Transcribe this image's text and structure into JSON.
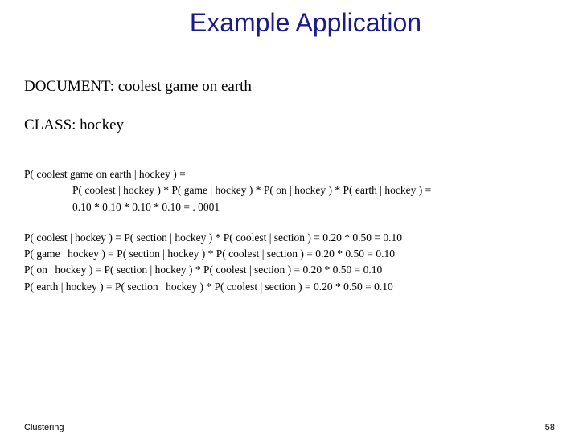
{
  "title": "Example Application",
  "document": {
    "label": "DOCUMENT:",
    "value": "coolest game on earth"
  },
  "class": {
    "label": "CLASS:",
    "value": "hockey"
  },
  "probability": {
    "main_line": "P( coolest game on earth | hockey ) =",
    "expansion": "P( coolest | hockey ) * P( game | hockey ) * P( on | hockey ) * P( earth | hockey ) =",
    "numeric": "0.10 * 0.10 * 0.10 * 0.10 = . 0001"
  },
  "details": [
    "P( coolest | hockey ) = P( section | hockey ) * P( coolest | section ) = 0.20 * 0.50 = 0.10",
    "P( game | hockey ) = P( section | hockey ) * P( coolest | section ) = 0.20 * 0.50 = 0.10",
    "P( on | hockey ) = P( section | hockey ) * P( coolest | section ) = 0.20 * 0.50 = 0.10",
    "P( earth | hockey ) = P( section | hockey ) * P( coolest | section ) = 0.20 * 0.50 = 0.10"
  ],
  "footer": {
    "left": "Clustering",
    "right": "58"
  }
}
